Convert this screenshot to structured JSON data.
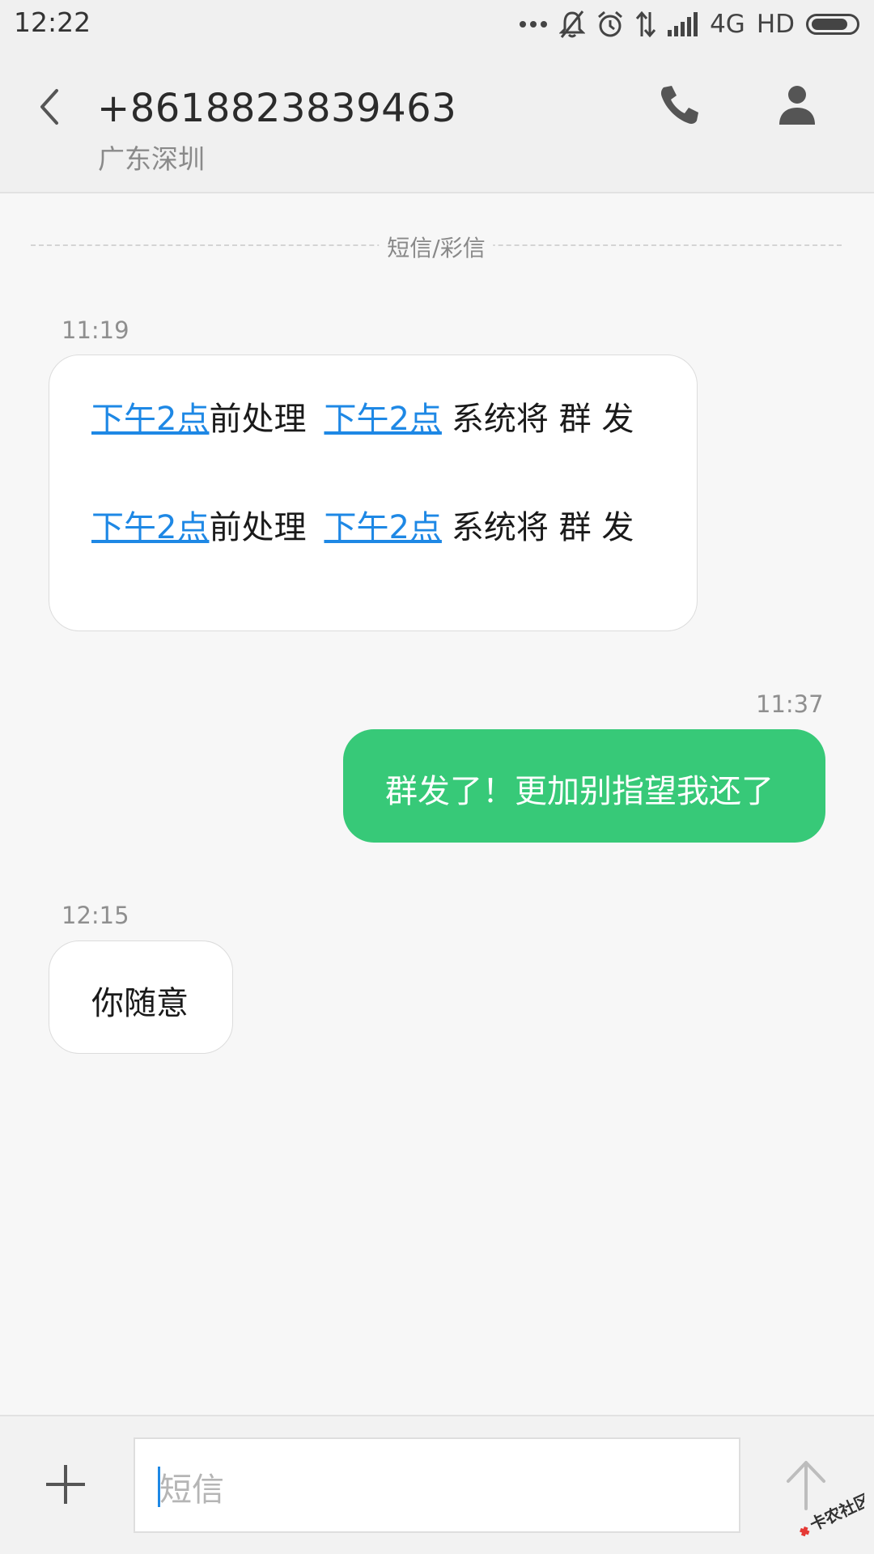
{
  "status_bar": {
    "time": "12:22",
    "network": "4G",
    "hd": "HD",
    "battery_level": 0.85
  },
  "header": {
    "contact_number": "+8618823839463",
    "contact_location": "广东深圳",
    "back_icon": "chevron-left-icon",
    "call_icon": "phone-icon",
    "contact_icon": "person-icon"
  },
  "divider_label": "短信/彩信",
  "messages": [
    {
      "direction": "incoming",
      "time": "11:19",
      "lines": [
        {
          "link1": "下午2点",
          "text1": "前处理",
          "link2": "下午2点",
          "text2": "系统将 群 发"
        },
        {
          "link1": "下午2点",
          "text1": "前处理",
          "link2": "下午2点",
          "text2": "系统将 群 发"
        }
      ]
    },
    {
      "direction": "outgoing",
      "time": "11:37",
      "text": "群发了！更加别指望我还了"
    },
    {
      "direction": "incoming",
      "time": "12:15",
      "text": "你随意"
    }
  ],
  "input": {
    "placeholder": "短信",
    "attach_icon": "plus-icon",
    "send_icon": "arrow-up-icon"
  },
  "watermark": {
    "text": "卡农社区"
  },
  "colors": {
    "accent_link": "#1e88e5",
    "outgoing_bubble": "#37c978"
  }
}
